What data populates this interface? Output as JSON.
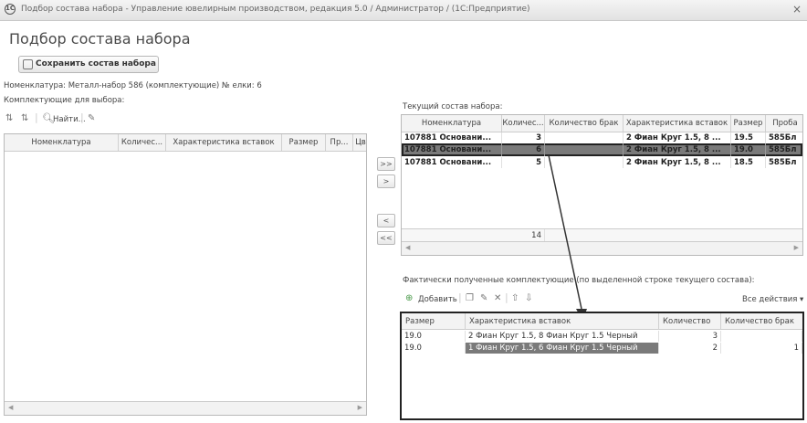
{
  "window": {
    "title": "Подбор состава набора - Управление ювелирным производством, редакция 5.0 / Администратор / (1С:Предприятие)",
    "close": "×",
    "logo": "1c-logo-icon"
  },
  "page_title": "Подбор состава набора",
  "save_button": "Сохранить состав набора",
  "info_line": "Номенклатура: Металл-набор 586 (комплектующие)   № елки: 6",
  "left_section_label": "Комплектующие для выбора:",
  "left_toolbar": {
    "find": "Найти..."
  },
  "left_table": {
    "columns": [
      "Номенклатура",
      "Количес...",
      "Характеристика вставок",
      "Размер",
      "Пр...",
      "Цв"
    ]
  },
  "transfer_buttons": [
    ">>",
    ">",
    "<",
    "<<"
  ],
  "current_section_label": "Текущий состав набора:",
  "current_table": {
    "columns": [
      "Номенклатура",
      "Количес...",
      "Количество брак",
      "Характеристика вставок",
      "Размер",
      "Проба"
    ],
    "rows": [
      {
        "nom": "107881 Основани...",
        "qty": "3",
        "brak": "",
        "char": "2 Фиан Круг 1.5, 8 ...",
        "size": "19.5",
        "proba": "585Бл"
      },
      {
        "nom": "107881 Основани...",
        "qty": "6",
        "brak": "",
        "char": "2 Фиан Круг 1.5, 8 ...",
        "size": "19.0",
        "proba": "585Бл"
      },
      {
        "nom": "107881 Основани...",
        "qty": "5",
        "brak": "",
        "char": "2 Фиан Круг 1.5, 8 ...",
        "size": "18.5",
        "proba": "585Бл"
      }
    ],
    "total": "14"
  },
  "actual_section_label": "Фактически полученные комплектующие (по выделенной строке текущего состава):",
  "actual_toolbar": {
    "add": "Добавить",
    "all_actions": "Все действия ▾"
  },
  "actual_table": {
    "columns": [
      "Размер",
      "Характеристика вставок",
      "Количество",
      "Количество брак"
    ],
    "rows": [
      {
        "size": "19.0",
        "char": "2 Фиан Круг 1.5, 8 Фиан Круг 1.5 Черный",
        "qty": "3",
        "brak": ""
      },
      {
        "size": "19.0",
        "char": "1 Фиан Круг 1.5, 6 Фиан Круг 1.5 Черный",
        "qty": "2",
        "brak": "1"
      }
    ]
  }
}
